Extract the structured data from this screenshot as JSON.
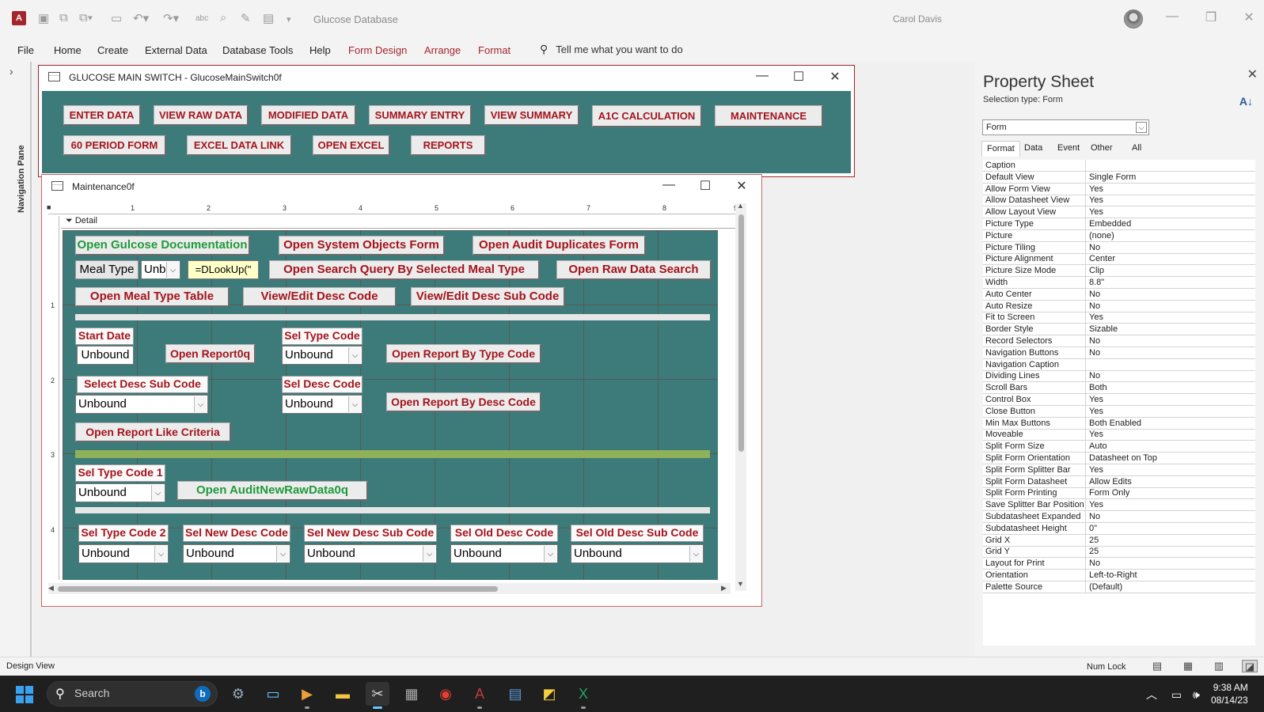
{
  "app": {
    "window_title": "Glucose Database",
    "user_name": "Carol Davis"
  },
  "menu": {
    "items": [
      "File",
      "Home",
      "Create",
      "External Data",
      "Database Tools",
      "Help",
      "Form Design",
      "Arrange",
      "Format"
    ],
    "tell_me": "Tell me what you want to do"
  },
  "nav_pane": {
    "label": "Navigation Pane"
  },
  "main_switch": {
    "caption": "GLUCOSE MAIN SWITCH - GlucoseMainSwitch0f",
    "buttons": [
      "ENTER DATA",
      "VIEW RAW DATA",
      "MODIFIED DATA",
      "SUMMARY ENTRY",
      "VIEW SUMMARY",
      "A1C CALCULATION",
      "MAINTENANCE",
      "60 PERIOD FORM",
      "EXCEL DATA LINK",
      "OPEN EXCEL",
      "REPORTS"
    ]
  },
  "maintenance": {
    "caption": "Maintenance0f",
    "detail_label": "Detail",
    "ruler_h": [
      "1",
      "2",
      "3",
      "4",
      "5",
      "6",
      "7",
      "8",
      "9"
    ],
    "ruler_v": [
      "1",
      "2",
      "3",
      "4"
    ],
    "btn_open_doc": "Open Gulcose Documentation",
    "btn_sys_objects": "Open System Objects Form",
    "btn_audit_dup": "Open Audit Duplicates Form",
    "lbl_meal_type": "Meal Type",
    "combo_meal_type": "Unb",
    "txt_dlookup": "=DLookUp(\"",
    "btn_search_query": "Open Search Query By Selected Meal Type",
    "btn_raw_search": "Open Raw Data Search",
    "btn_meal_table": "Open Meal Type Table",
    "btn_desc_code": "View/Edit Desc Code",
    "btn_desc_sub": "View/Edit Desc Sub Code",
    "lbl_start_date": "Start Date",
    "txt_start_date": "Unbound",
    "btn_report0q": "Open Report0q",
    "lbl_sel_type": "Sel Type Code",
    "combo_sel_type": "Unbound",
    "btn_report_type": "Open Report By Type Code",
    "lbl_select_desc_sub": "Select Desc Sub Code",
    "combo_select_desc_sub": "Unbound",
    "lbl_sel_desc": "Sel Desc Code",
    "combo_sel_desc": "Unbound",
    "btn_report_desc": "Open Report By Desc Code",
    "btn_report_like": "Open Report Like Criteria",
    "lbl_sel_type1": "Sel Type Code 1",
    "combo_sel_type1": "Unbound",
    "btn_audit_new": "Open AuditNewRawData0q",
    "lbl_sel_type2": "Sel Type Code 2",
    "combo_sel_type2": "Unbound",
    "lbl_new_desc": "Sel New Desc Code",
    "combo_new_desc": "Unbound",
    "lbl_new_desc_sub": "Sel New Desc Sub Code",
    "combo_new_desc_sub": "Unbound",
    "lbl_old_desc": "Sel Old Desc Code",
    "combo_old_desc": "Unbound",
    "lbl_old_desc_sub": "Sel Old Desc Sub Code",
    "combo_old_desc_sub": "Unbound"
  },
  "property_sheet": {
    "title": "Property Sheet",
    "selection_type": "Selection type:  Form",
    "selected_object": "Form",
    "tabs": [
      "Format",
      "Data",
      "Event",
      "Other",
      "All"
    ],
    "properties": [
      {
        "k": "Caption",
        "v": ""
      },
      {
        "k": "Default View",
        "v": "Single Form"
      },
      {
        "k": "Allow Form View",
        "v": "Yes"
      },
      {
        "k": "Allow Datasheet View",
        "v": "Yes"
      },
      {
        "k": "Allow Layout View",
        "v": "Yes"
      },
      {
        "k": "Picture Type",
        "v": "Embedded"
      },
      {
        "k": "Picture",
        "v": "(none)"
      },
      {
        "k": "Picture Tiling",
        "v": "No"
      },
      {
        "k": "Picture Alignment",
        "v": "Center"
      },
      {
        "k": "Picture Size Mode",
        "v": "Clip"
      },
      {
        "k": "Width",
        "v": "8.8\""
      },
      {
        "k": "Auto Center",
        "v": "No"
      },
      {
        "k": "Auto Resize",
        "v": "No"
      },
      {
        "k": "Fit to Screen",
        "v": "Yes"
      },
      {
        "k": "Border Style",
        "v": "Sizable"
      },
      {
        "k": "Record Selectors",
        "v": "No"
      },
      {
        "k": "Navigation Buttons",
        "v": "No"
      },
      {
        "k": "Navigation Caption",
        "v": ""
      },
      {
        "k": "Dividing Lines",
        "v": "No"
      },
      {
        "k": "Scroll Bars",
        "v": "Both"
      },
      {
        "k": "Control Box",
        "v": "Yes"
      },
      {
        "k": "Close Button",
        "v": "Yes"
      },
      {
        "k": "Min Max Buttons",
        "v": "Both Enabled"
      },
      {
        "k": "Moveable",
        "v": "Yes"
      },
      {
        "k": "Split Form Size",
        "v": "Auto"
      },
      {
        "k": "Split Form Orientation",
        "v": "Datasheet on Top"
      },
      {
        "k": "Split Form Splitter Bar",
        "v": "Yes"
      },
      {
        "k": "Split Form Datasheet",
        "v": "Allow Edits"
      },
      {
        "k": "Split Form Printing",
        "v": "Form Only"
      },
      {
        "k": "Save Splitter Bar Position",
        "v": "Yes"
      },
      {
        "k": "Subdatasheet Expanded",
        "v": "No"
      },
      {
        "k": "Subdatasheet Height",
        "v": "0\""
      },
      {
        "k": "Grid X",
        "v": "25"
      },
      {
        "k": "Grid Y",
        "v": "25"
      },
      {
        "k": "Layout for Print",
        "v": "No"
      },
      {
        "k": "Orientation",
        "v": "Left-to-Right"
      },
      {
        "k": "Palette Source",
        "v": "(Default)"
      }
    ]
  },
  "status": {
    "text": "Design View",
    "num_lock": "Num Lock"
  },
  "taskbar": {
    "search_placeholder": "Search",
    "time": "9:38 AM",
    "date": "08/14/23"
  },
  "colors": {
    "accent": "#a4262c",
    "form_back": "#3d7a7a",
    "button_text": "#a4141c",
    "green_text": "#1e9a3a",
    "line_green": "#8fb15a"
  }
}
